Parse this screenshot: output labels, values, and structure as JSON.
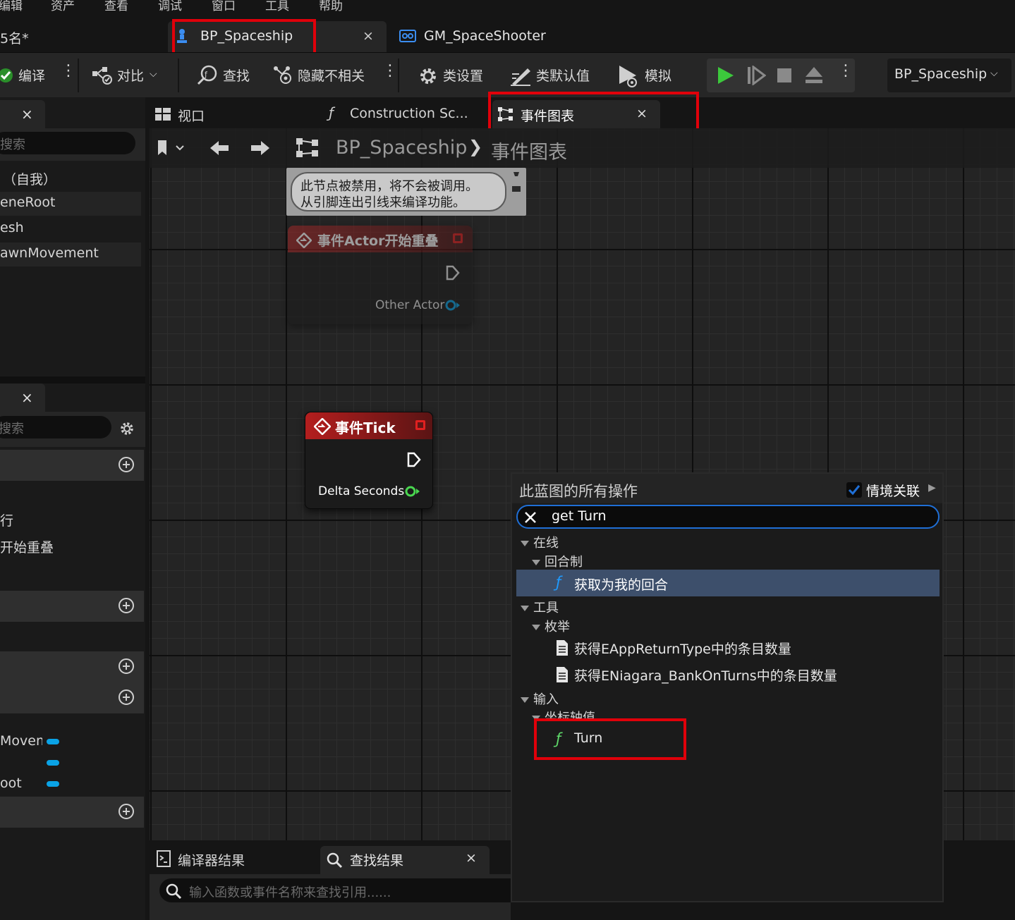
{
  "menu": [
    "编辑",
    "资产",
    "查看",
    "调试",
    "窗口",
    "工具",
    "帮助"
  ],
  "doc_tabs": {
    "left_partial": "5名*",
    "active": {
      "label": "BP_Spaceship",
      "close": "×"
    },
    "second": {
      "label": "GM_SpaceShooter"
    }
  },
  "toolbar": {
    "compile": "编译",
    "diff": "对比",
    "find": "查找",
    "hide_unrelated": "隐藏不相关",
    "class_settings": "类设置",
    "class_defaults": "类默认值",
    "simulate": "模拟",
    "blueprint_select": "BP_Spaceship"
  },
  "left_panel": {
    "top_close": "×",
    "search1_placeholder": "搜索",
    "components": [
      "（自我）",
      "eneRoot",
      "esh",
      "awnMovement"
    ],
    "mid_close": "×",
    "search2_placeholder": "搜索",
    "list_items": [
      "行",
      "开始重叠"
    ],
    "vars": [
      "Moveme",
      "",
      "oot"
    ]
  },
  "graph_tabs": {
    "viewport": "视口",
    "construction": "Construction Sc...",
    "event_graph": "事件图表",
    "close": "×"
  },
  "breadcrumb": {
    "root": "BP_Spaceship",
    "separator": "❯",
    "current": "事件图表"
  },
  "comment_node": {
    "line1": "此节点被禁用，将不会被调用。",
    "line2": "从引脚连出引线来编译功能。"
  },
  "overlap_node": {
    "title": "事件Actor开始重叠",
    "pin": "Other Actor"
  },
  "tick_node": {
    "title": "事件Tick",
    "pin": "Delta Seconds"
  },
  "action_menu": {
    "title": "此蓝图的所有操作",
    "context_label": "情境关联",
    "context_checked": true,
    "search_value": "get Turn",
    "tree": [
      {
        "level": 0,
        "type": "category",
        "label": "在线"
      },
      {
        "level": 1,
        "type": "category",
        "label": "回合制"
      },
      {
        "level": 2,
        "type": "function",
        "label": "获取为我的回合",
        "selected": true
      },
      {
        "level": 0,
        "type": "category",
        "label": "工具"
      },
      {
        "level": 1,
        "type": "category",
        "label": "枚举"
      },
      {
        "level": 2,
        "type": "doc",
        "label": "获得EAppReturnType中的条目数量"
      },
      {
        "level": 2,
        "type": "doc",
        "label": "获得ENiagara_BankOnTurns中的条目数量"
      },
      {
        "level": 0,
        "type": "category",
        "label": "输入"
      },
      {
        "level": 1,
        "type": "category",
        "label": "坐标轴值"
      },
      {
        "level": 2,
        "type": "function",
        "label": "Turn"
      }
    ]
  },
  "bottom_panel": {
    "compiler_results": "编译器结果",
    "find_results": "查找结果",
    "close": "×",
    "search_placeholder": "输入函数或事件名称来查找引用......"
  },
  "colors": {
    "highlight_red": "#e0000a",
    "accent_blue": "#1f6fd6",
    "play_green": "#3cc83c",
    "exec_pin_green": "#49d64f",
    "object_pin_blue": "#0aa3e6",
    "selected_row": "#3d4f6b"
  }
}
